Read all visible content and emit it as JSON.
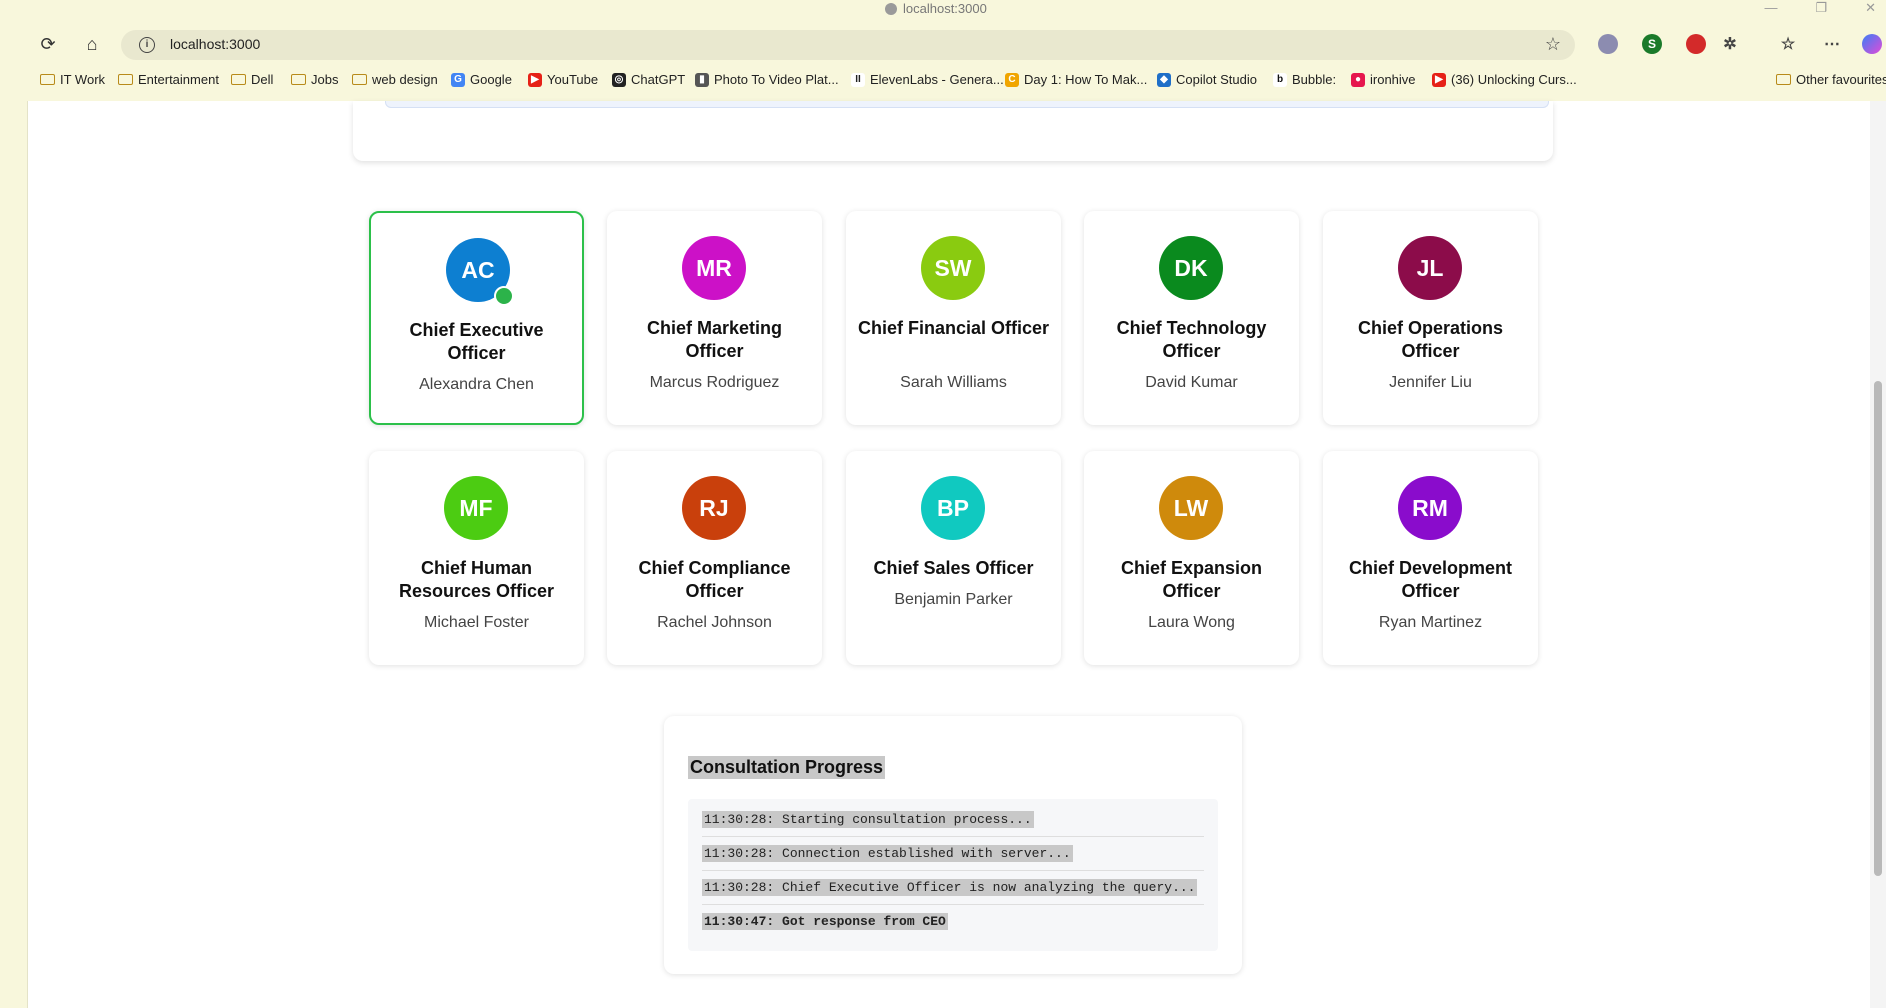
{
  "browser": {
    "window_title": "localhost:3000",
    "url": "localhost:3000",
    "bookmarks": [
      {
        "label": "IT Work",
        "type": "folder"
      },
      {
        "label": "Entertainment",
        "type": "folder"
      },
      {
        "label": "Dell",
        "type": "folder"
      },
      {
        "label": "Jobs",
        "type": "folder"
      },
      {
        "label": "web design",
        "type": "folder"
      },
      {
        "label": "Google",
        "type": "site"
      },
      {
        "label": "YouTube",
        "type": "site"
      },
      {
        "label": "ChatGPT",
        "type": "site"
      },
      {
        "label": "Photo To Video Plat...",
        "type": "site"
      },
      {
        "label": "ElevenLabs - Genera...",
        "type": "site"
      },
      {
        "label": "Day 1: How To Mak...",
        "type": "site"
      },
      {
        "label": "Copilot Studio",
        "type": "site"
      },
      {
        "label": "Bubble:",
        "type": "site"
      },
      {
        "label": "ironhive",
        "type": "site"
      },
      {
        "label": "(36) Unlocking Curs...",
        "type": "site"
      }
    ],
    "other_favourites": "Other favourites",
    "extension_badge": "0"
  },
  "executives": [
    {
      "initials": "AC",
      "role": "Chief Executive Officer",
      "name": "Alexandra Chen",
      "color": "#0d7fd1",
      "selected": true
    },
    {
      "initials": "MR",
      "role": "Chief Marketing Officer",
      "name": "Marcus Rodriguez",
      "color": "#cc11c7"
    },
    {
      "initials": "SW",
      "role": "Chief Financial Officer",
      "name": "Sarah Williams",
      "color": "#8acb10"
    },
    {
      "initials": "DK",
      "role": "Chief Technology Officer",
      "name": "David Kumar",
      "color": "#0a8a1e"
    },
    {
      "initials": "JL",
      "role": "Chief Operations Officer",
      "name": "Jennifer Liu",
      "color": "#8c0c4a"
    },
    {
      "initials": "MF",
      "role": "Chief Human Resources Officer",
      "name": "Michael Foster",
      "color": "#4ccc12"
    },
    {
      "initials": "RJ",
      "role": "Chief Compliance Officer",
      "name": "Rachel Johnson",
      "color": "#c9400c"
    },
    {
      "initials": "BP",
      "role": "Chief Sales Officer",
      "name": "Benjamin Parker",
      "color": "#10c9c0"
    },
    {
      "initials": "LW",
      "role": "Chief Expansion Officer",
      "name": "Laura Wong",
      "color": "#cf8a0c"
    },
    {
      "initials": "RM",
      "role": "Chief Development Officer",
      "name": "Ryan Martinez",
      "color": "#8a0ccc"
    }
  ],
  "progress": {
    "title": "Consultation Progress",
    "logs": [
      {
        "text": "11:30:28: Starting consultation process...",
        "bold": false
      },
      {
        "text": "11:30:28: Connection established with server...",
        "bold": false
      },
      {
        "text": "11:30:28: Chief Executive Officer is now analyzing the query...",
        "bold": false
      },
      {
        "text": "11:30:47: Got response from CEO",
        "bold": true
      }
    ]
  }
}
